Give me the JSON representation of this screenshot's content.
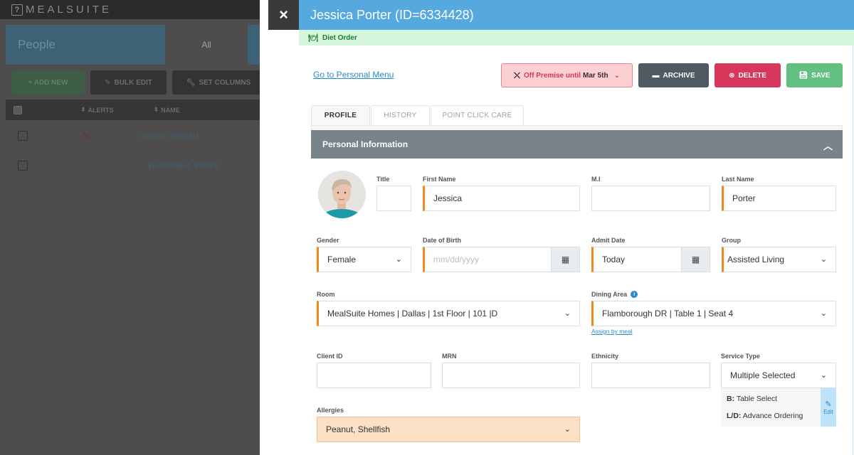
{
  "background_app": {
    "logo_icon": "question-box-icon",
    "logo_text": "MEALSUITE",
    "header_title": "People",
    "filter_tab": "All",
    "buttons": [
      {
        "label": "+ ADD NEW",
        "icon": "plus-icon"
      },
      {
        "label": "BULK EDIT",
        "icon": "edit-icon"
      },
      {
        "label": "SET COLUMNS",
        "icon": "wrench-icon"
      }
    ],
    "table_headers": [
      "ALERTS",
      "NAME"
    ],
    "rows": [
      {
        "name": "Kumar, stewart",
        "alert_icon": "off-premise-icon"
      },
      {
        "name": "Bananahat, Prince",
        "alert_icon": ""
      }
    ]
  },
  "modal": {
    "close_icon": "×",
    "title": "Jessica Porter (ID=6334428)",
    "diet_order": {
      "icon": "plate-utensils-icon",
      "label": "Diet Order"
    },
    "personal_menu_link": "Go to Personal Menu",
    "actions": {
      "off_premise": {
        "prefix": "Off Premise until",
        "date": "Mar 5th"
      },
      "archive": "ARCHIVE",
      "delete": "DELETE",
      "save": "SAVE"
    },
    "tabs": [
      {
        "label": "PROFILE",
        "active": true
      },
      {
        "label": "HISTORY",
        "active": false
      },
      {
        "label": "POINT CLICK CARE",
        "active": false
      }
    ],
    "section_title": "Personal Information",
    "fields": {
      "title": {
        "label": "Title",
        "value": ""
      },
      "first_name": {
        "label": "First Name",
        "value": "Jessica"
      },
      "mi": {
        "label": "M.I",
        "value": ""
      },
      "last_name": {
        "label": "Last Name",
        "value": "Porter"
      },
      "gender": {
        "label": "Gender",
        "value": "Female"
      },
      "dob": {
        "label": "Date of Birth",
        "value": "",
        "placeholder": "mm/dd/yyyy"
      },
      "admit_date": {
        "label": "Admit Date",
        "value": "Today"
      },
      "group": {
        "label": "Group",
        "value": "Assisted Living"
      },
      "room": {
        "label": "Room",
        "value": "MealSuite Homes | Dallas | 1st Floor | 101 |D"
      },
      "dining_area": {
        "label": "Dining Area",
        "value": "Flamborough DR | Table 1 | Seat 4",
        "link": "Assign by meal"
      },
      "client_id": {
        "label": "Client ID",
        "value": ""
      },
      "mrn": {
        "label": "MRN",
        "value": ""
      },
      "ethnicity": {
        "label": "Ethnicity",
        "value": ""
      },
      "service_type": {
        "label": "Service Type",
        "value": "Multiple Selected",
        "details": [
          {
            "meal": "B:",
            "type": "Table Select"
          },
          {
            "meal": "L/D:",
            "type": "Advance Ordering"
          }
        ],
        "edit_label": "Edit"
      },
      "allergies": {
        "label": "Allergies",
        "value": "Peanut, Shellfish"
      }
    }
  },
  "colors": {
    "title_bar": "#55a9de",
    "diet_bar": "#d5f5dd",
    "required_accent": "#f0891c",
    "delete": "#d7375a",
    "save": "#62c081",
    "archive": "#4f5a62",
    "allergy_bg": "#fce0c5"
  }
}
